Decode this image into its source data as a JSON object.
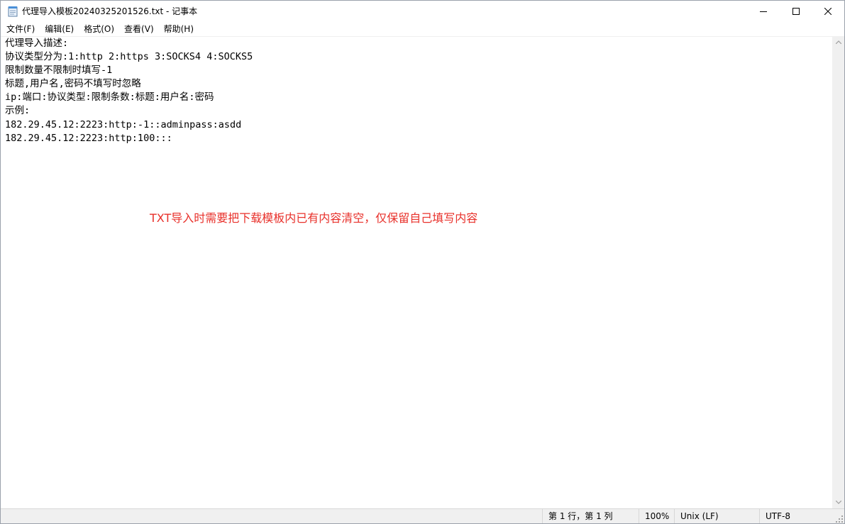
{
  "window": {
    "title": "代理导入模板20240325201526.txt - 记事本"
  },
  "menu": {
    "items": [
      "文件(F)",
      "编辑(E)",
      "格式(O)",
      "查看(V)",
      "帮助(H)"
    ]
  },
  "editor": {
    "lines": [
      "代理导入描述:",
      "协议类型分为:1:http 2:https 3:SOCKS4 4:SOCKS5",
      "限制数量不限制时填写-1",
      "标题,用户名,密码不填写时忽略",
      "ip:端口:协议类型:限制条数:标题:用户名:密码",
      "示例:",
      "182.29.45.12:2223:http:-1::adminpass:asdd",
      "182.29.45.12:2223:http:100:::"
    ]
  },
  "annotation": {
    "text": "TXT导入时需要把下载模板内已有内容清空，仅保留自己填写内容",
    "color": "#e8302a"
  },
  "statusbar": {
    "position": "第 1 行，第 1 列",
    "zoom": "100%",
    "line_ending": "Unix (LF)",
    "encoding": "UTF-8"
  },
  "icons": {
    "app": "notepad-icon",
    "minimize": "minimize-icon",
    "maximize": "maximize-icon",
    "close": "close-icon"
  }
}
